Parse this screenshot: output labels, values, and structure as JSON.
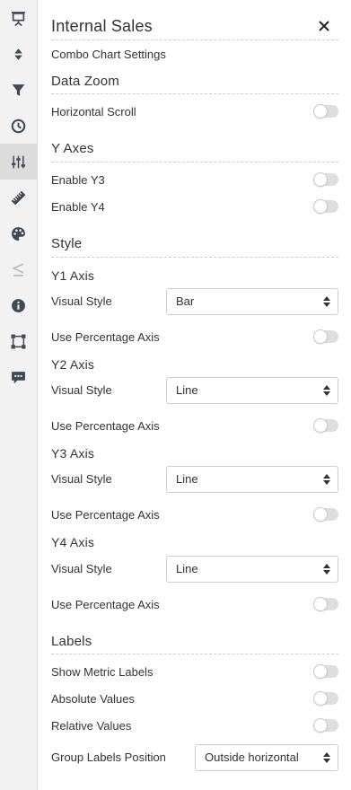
{
  "rail": {
    "items": [
      {
        "icon": "presentation-icon"
      },
      {
        "icon": "sort-icon"
      },
      {
        "icon": "filter-icon"
      },
      {
        "icon": "clock-icon"
      },
      {
        "icon": "sliders-icon",
        "active": true
      },
      {
        "icon": "ruler-icon"
      },
      {
        "icon": "palette-icon"
      },
      {
        "icon": "less-equal-icon"
      },
      {
        "icon": "info-icon"
      },
      {
        "icon": "selection-icon"
      },
      {
        "icon": "comment-icon"
      }
    ]
  },
  "header": {
    "title": "Internal Sales",
    "subtitle": "Combo Chart Settings"
  },
  "data_zoom": {
    "heading": "Data Zoom",
    "horizontal_scroll": {
      "label": "Horizontal Scroll",
      "on": false
    }
  },
  "y_axes": {
    "heading": "Y Axes",
    "enable_y3": {
      "label": "Enable Y3",
      "on": false
    },
    "enable_y4": {
      "label": "Enable Y4",
      "on": false
    }
  },
  "style": {
    "heading": "Style",
    "axes": [
      {
        "name": "Y1 Axis",
        "visual_style_label": "Visual Style",
        "visual_style": "Bar",
        "percentage_label": "Use Percentage Axis",
        "percentage_on": false
      },
      {
        "name": "Y2 Axis",
        "visual_style_label": "Visual Style",
        "visual_style": "Line",
        "percentage_label": "Use Percentage Axis",
        "percentage_on": false
      },
      {
        "name": "Y3 Axis",
        "visual_style_label": "Visual Style",
        "visual_style": "Line",
        "percentage_label": "Use Percentage Axis",
        "percentage_on": false
      },
      {
        "name": "Y4 Axis",
        "visual_style_label": "Visual Style",
        "visual_style": "Line",
        "percentage_label": "Use Percentage Axis",
        "percentage_on": false
      }
    ]
  },
  "labels": {
    "heading": "Labels",
    "show_metric_labels": {
      "label": "Show Metric Labels",
      "on": false
    },
    "absolute_values": {
      "label": "Absolute Values",
      "on": false
    },
    "relative_values": {
      "label": "Relative Values",
      "on": false
    },
    "group_labels_position": {
      "label": "Group Labels Position",
      "value": "Outside horizontal"
    }
  },
  "colors": {
    "rail_bg": "#f2f2f2",
    "rail_active": "#dcdcdc",
    "icon": "#3f4a55",
    "icon_disabled": "#b8bcc0",
    "toggle_off": "#dedede"
  }
}
